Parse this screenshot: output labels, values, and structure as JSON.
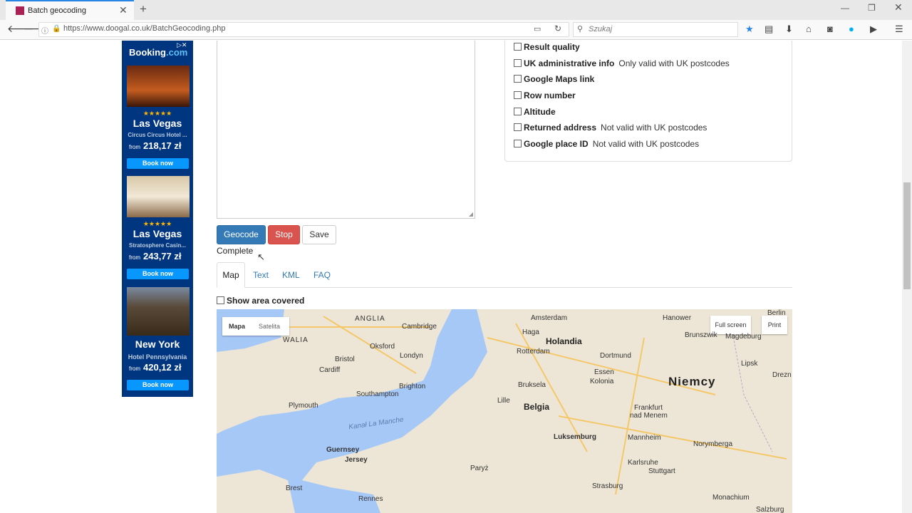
{
  "browser": {
    "tab_title": "Batch geocoding",
    "url": "https://www.doogal.co.uk/BatchGeocoding.php",
    "search_placeholder": "Szukaj"
  },
  "ad": {
    "brand_a": "Booking",
    "brand_b": ".com",
    "items": [
      {
        "stars": "★★★★★",
        "city": "Las Vegas",
        "hotel": "Circus Circus Hotel ...",
        "from": "from",
        "price": "218,17 zł",
        "button": "Book now"
      },
      {
        "stars": "★★★★★",
        "city": "Las Vegas",
        "hotel": "Stratosphere Casin...",
        "from": "from",
        "price": "243,77 zł",
        "button": "Book now"
      },
      {
        "stars": "",
        "city": "New York",
        "hotel": "Hotel Pennsylvania",
        "from": "from",
        "price": "420,12 zł",
        "button": "Book now"
      }
    ]
  },
  "options": [
    {
      "label": "Result quality",
      "note": ""
    },
    {
      "label": "UK administrative info",
      "note": "Only valid with UK postcodes"
    },
    {
      "label": "Google Maps link",
      "note": ""
    },
    {
      "label": "Row number",
      "note": ""
    },
    {
      "label": "Altitude",
      "note": ""
    },
    {
      "label": "Returned address",
      "note": "Not valid with UK postcodes"
    },
    {
      "label": "Google place ID",
      "note": "Not valid with UK postcodes"
    }
  ],
  "buttons": {
    "geocode": "Geocode",
    "stop": "Stop",
    "save": "Save"
  },
  "status": "Complete",
  "tabs": [
    "Map",
    "Text",
    "KML",
    "FAQ"
  ],
  "show_area": "Show area covered",
  "map": {
    "type_map": "Mapa",
    "type_sat": "Satelita",
    "fullscreen": "Full screen",
    "print": "Print",
    "labels": {
      "anglia": "ANGLIA",
      "walia": "WALIA",
      "cambridge": "Cambridge",
      "oksford": "Oksford",
      "londyn": "Londyn",
      "bristol": "Bristol",
      "cardiff": "Cardiff",
      "southampton": "Southampton",
      "brighton": "Brighton",
      "plymouth": "Plymouth",
      "kanal": "Kanał La Manche",
      "guernsey": "Guernsey",
      "jersey": "Jersey",
      "brest": "Brest",
      "rennes": "Rennes",
      "amsterdam": "Amsterdam",
      "haga": "Haga",
      "holandia": "Holandia",
      "rotterdam": "Rotterdam",
      "dortmund": "Dortmund",
      "essen": "Essen",
      "kolonia": "Kolonia",
      "bruksela": "Bruksela",
      "lille": "Lille",
      "belgia": "Belgia",
      "luksemburg": "Luksemburg",
      "paryz": "Paryż",
      "hanower": "Hanower",
      "brunszwik": "Brunszwik",
      "magdeburg": "Magdeburg",
      "berlin": "Berlin",
      "niemcy": "Niemcy",
      "lipsk": "Lipsk",
      "drezno": "Drezn",
      "frankfurt": "Frankfurt",
      "nadmenem": "nad Menem",
      "mannheim": "Mannheim",
      "norymberga": "Norymberga",
      "karlsruhe": "Karlsruhe",
      "stuttgart": "Stuttgart",
      "strasburg": "Strasburg",
      "monachium": "Monachium",
      "salzburg": "Salzburg"
    }
  }
}
